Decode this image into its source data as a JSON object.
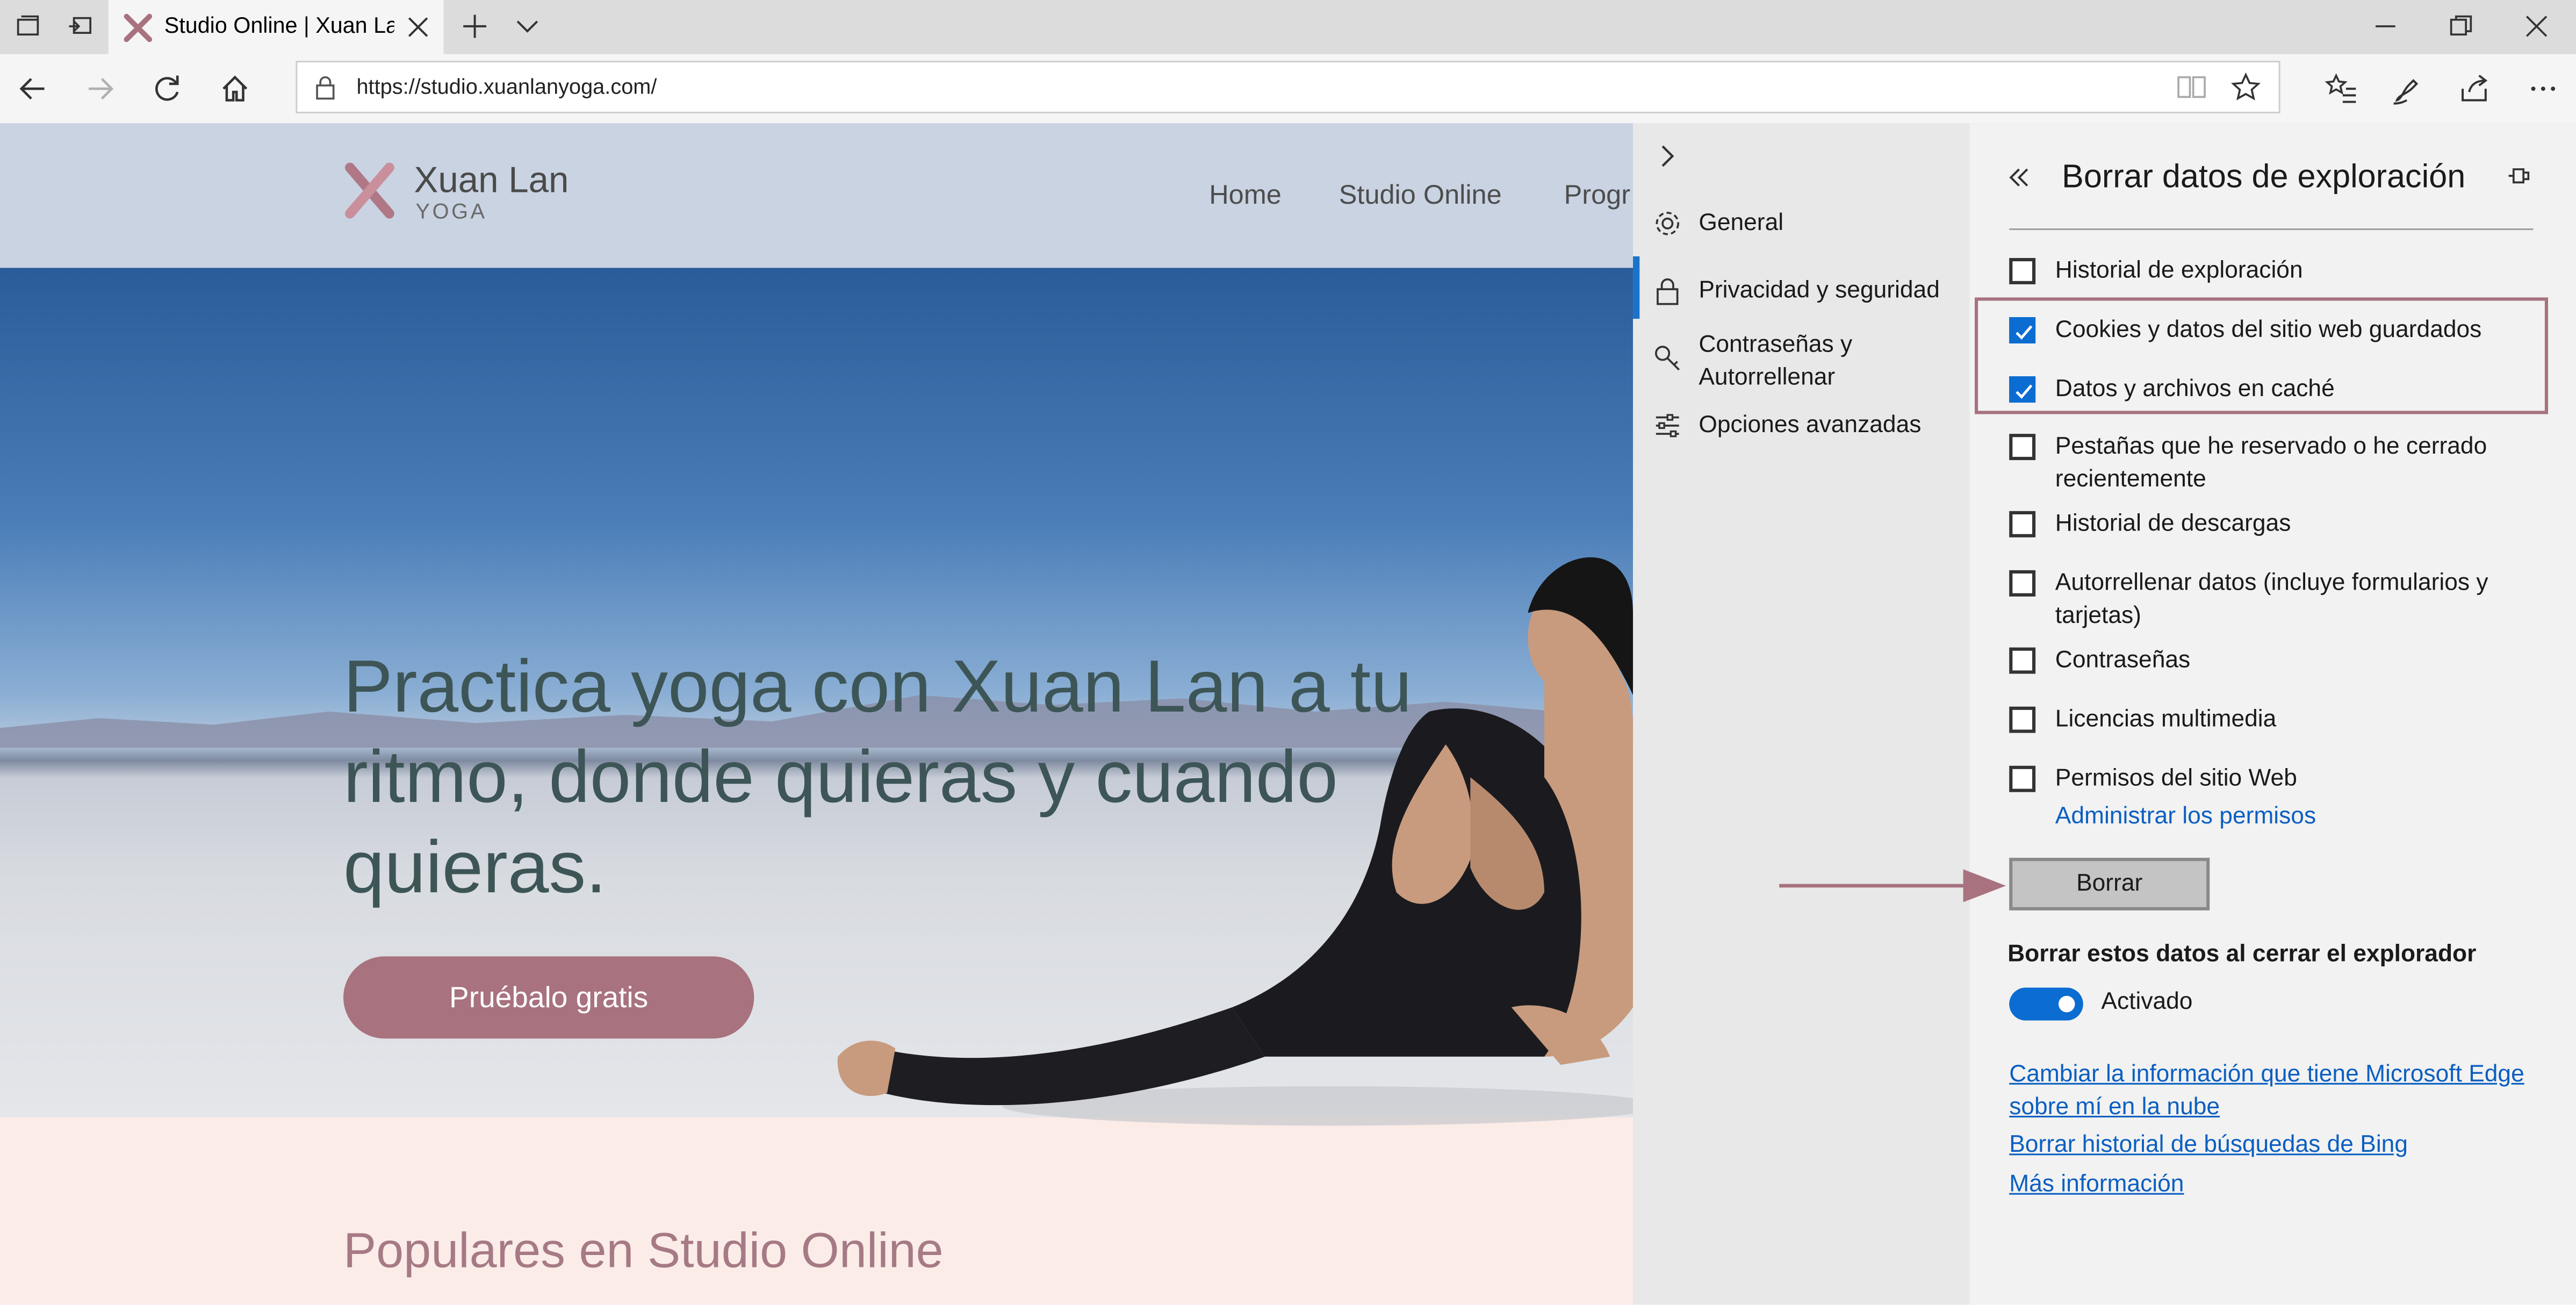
{
  "tab": {
    "title": "Studio Online | Xuan Lan",
    "new_tab_icon": "plus-icon",
    "tab_list_icon": "chevron-down-icon"
  },
  "window": {
    "minimize_icon": "minimize-icon",
    "restore_icon": "restore-icon",
    "close_icon": "close-icon"
  },
  "address_bar": {
    "url": "https://studio.xuanlanyoga.com/"
  },
  "site": {
    "logo_name": "Xuan Lan",
    "logo_sub": "YOGA",
    "nav": [
      "Home",
      "Studio Online",
      "Progr"
    ],
    "headline": "Practica yoga con Xuan Lan a tu ritmo, donde quieras y cuando quieras.",
    "cta": "Pruébalo gratis",
    "section_title": "Populares en Studio Online"
  },
  "settings_nav": {
    "items": [
      {
        "label": "General",
        "icon": "gear-icon"
      },
      {
        "label": "Privacidad y seguridad",
        "icon": "lock-icon"
      },
      {
        "label": "Contraseñas y Autorrellenar",
        "icon": "key-icon"
      },
      {
        "label": "Opciones avanzadas",
        "icon": "sliders-icon"
      }
    ],
    "active_index": 1
  },
  "clear_pane": {
    "title": "Borrar datos de exploración",
    "options": [
      {
        "label": "Historial de exploración",
        "checked": false
      },
      {
        "label": "Cookies y datos del sitio web guardados",
        "checked": true
      },
      {
        "label": "Datos y archivos en caché",
        "checked": true
      },
      {
        "label": "Pestañas que he reservado o he cerrado recientemente",
        "checked": false
      },
      {
        "label": "Historial de descargas",
        "checked": false
      },
      {
        "label": "Autorrellenar datos (incluye formularios y tarjetas)",
        "checked": false
      },
      {
        "label": "Contraseñas",
        "checked": false
      },
      {
        "label": "Licencias multimedia",
        "checked": false
      },
      {
        "label": "Permisos del sitio Web",
        "checked": false
      }
    ],
    "manage_permissions_link": "Administrar los permisos",
    "clear_button": "Borrar",
    "clear_on_close_heading": "Borrar estos datos al cerrar el explorador",
    "toggle_label": "Activado",
    "toggle_on": true,
    "links": [
      "Cambiar la información que tiene Microsoft Edge sobre mí en la nube",
      "Borrar historial de búsquedas de Bing",
      "Más información"
    ]
  },
  "colors": {
    "accent": "#0b6cd1",
    "brand": "#a8727f",
    "highlight": "#a8727f"
  }
}
